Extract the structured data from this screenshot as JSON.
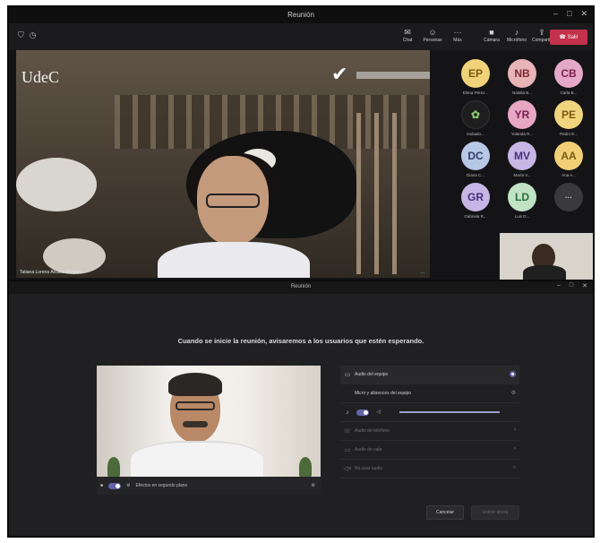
{
  "top_window": {
    "title": "Reunión",
    "toolbar": {
      "items": [
        "Chat",
        "Personas",
        "Más",
        "Cámara",
        "Micrófono",
        "Compartir"
      ],
      "leave_label": "Salir"
    },
    "stage": {
      "logo": "UdeC",
      "presenter_caption": "Tatiana Lorena Alcalde Bonnat...",
      "secondary_caption": "..."
    },
    "participants": [
      {
        "initials": "EP",
        "name": "Elena Pérez...",
        "color": "#f0d27a"
      },
      {
        "initials": "NB",
        "name": "Natalia B...",
        "color": "#e8b4b8"
      },
      {
        "initials": "CB",
        "name": "Carla B...",
        "color": "#e5a8c8"
      },
      {
        "initials": "",
        "name": "Invitado...",
        "color": "#1e1e1e"
      },
      {
        "initials": "YR",
        "name": "Yolanda R...",
        "color": "#e7a7c2"
      },
      {
        "initials": "PE",
        "name": "Pedro E...",
        "color": "#f1d47e"
      },
      {
        "initials": "DC",
        "name": "Diana C...",
        "color": "#b7c7e6"
      },
      {
        "initials": "MV",
        "name": "María V...",
        "color": "#c8b6e4"
      },
      {
        "initials": "AA",
        "name": "Ana A...",
        "color": "#f0cf76"
      },
      {
        "initials": "GR",
        "name": "Gabriela R...",
        "color": "#c7b5e5"
      },
      {
        "initials": "LD",
        "name": "Luis D...",
        "color": "#bfe3c4"
      },
      {
        "initials": "···",
        "name": "",
        "color": "#3a3a3c"
      }
    ]
  },
  "bottom_window": {
    "title": "Reunión",
    "notice": "Cuando se inicie la reunión, avisaremos a los usuarios que estén esperando.",
    "preview_bar": {
      "background_effects": "Efectos en segundo plano"
    },
    "options": {
      "computer_audio": "Audio del equipo",
      "mic_speakers": "Micro y altavoces del equipo",
      "phone_audio": "Audio de teléfono",
      "room_audio": "Audio de sala",
      "no_audio": "No usar audio"
    },
    "actions": {
      "cancel": "Cancelar",
      "join": "Unirse ahora"
    }
  },
  "colors": {
    "accent": "#6264a7",
    "leave": "#c4314b"
  }
}
